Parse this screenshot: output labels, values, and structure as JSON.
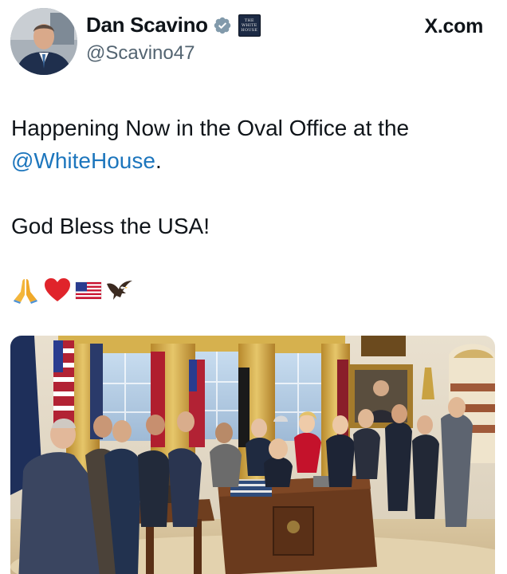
{
  "header": {
    "display_name": "Dan Scavino",
    "handle": "@Scavino47",
    "site_label": "X.com",
    "affiliation_badge_text": [
      "THE",
      "WHITE",
      "HOUSE"
    ]
  },
  "tweet": {
    "line1": "Happening Now in the Oval Office at the",
    "mention": "@WhiteHouse",
    "mention_suffix": ".",
    "line3": "God Bless the USA!",
    "emojis": [
      "folded-hands",
      "red-heart",
      "us-flag",
      "eagle"
    ]
  },
  "media": {
    "icon": "photo-oval-office"
  },
  "colors": {
    "mention": "#1d76bd",
    "verified": "#829aab",
    "handle": "#536471"
  }
}
